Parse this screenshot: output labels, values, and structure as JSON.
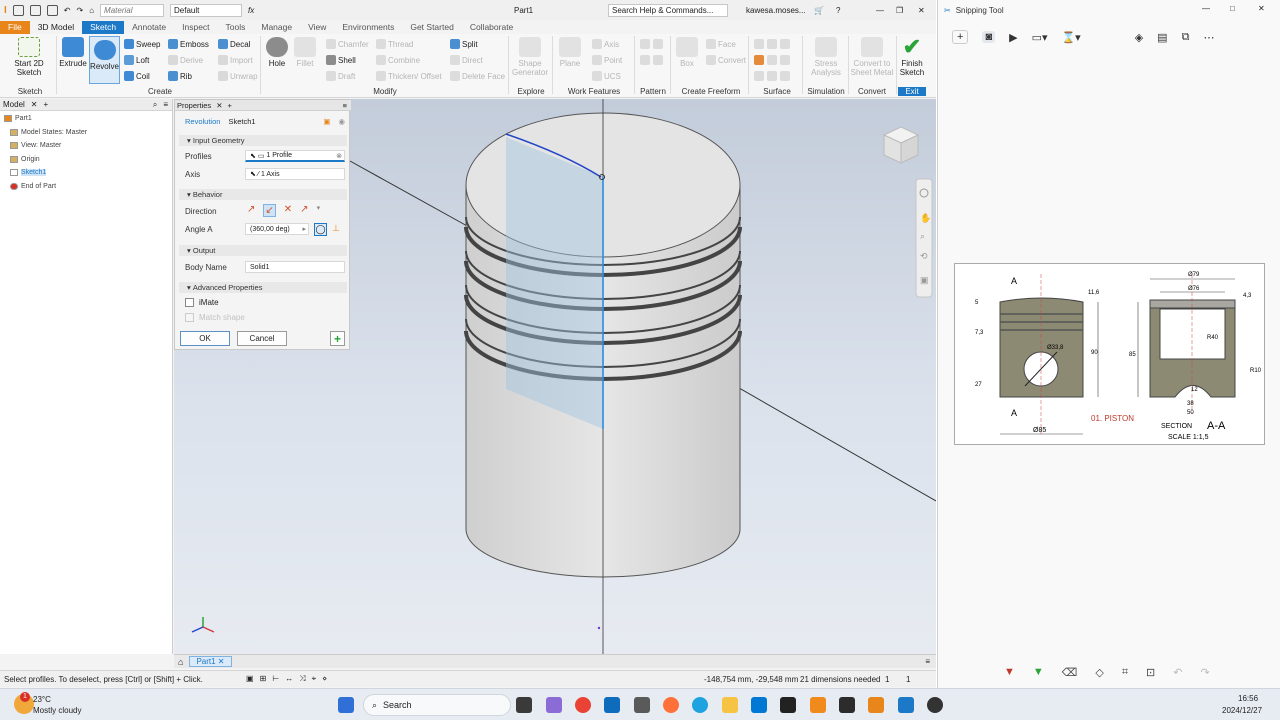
{
  "qat": {
    "material": "Material",
    "appearance": "Default",
    "title": "Part1",
    "search_placeholder": "Search Help & Commands...",
    "user": "kawesa.moses..."
  },
  "tabs": [
    "File",
    "3D Model",
    "Sketch",
    "Annotate",
    "Inspect",
    "Tools",
    "Manage",
    "View",
    "Environments",
    "Get Started",
    "Collaborate"
  ],
  "ribbon": {
    "start_sketch": "Start 2D Sketch",
    "extrude": "Extrude",
    "revolve": "Revolve",
    "sweep": "Sweep",
    "emboss": "Emboss",
    "decal": "Decal",
    "loft": "Loft",
    "derive": "Derive",
    "coil": "Coil",
    "import": "Import",
    "rib": "Rib",
    "unwrap": "Unwrap",
    "hole": "Hole",
    "fillet": "Fillet",
    "chamfer": "Chamfer",
    "thread": "Thread",
    "split": "Split",
    "shell": "Shell",
    "combine": "Combine",
    "direct": "Direct",
    "draft": "Draft",
    "thicken": "Thicken/ Offset",
    "delete_face": "Delete Face",
    "shape_generator": "Shape Generator",
    "plane": "Plane",
    "axis": "Axis",
    "point": "Point",
    "ucs": "UCS",
    "box": "Box",
    "face": "Face",
    "convert": "Convert",
    "stress": "Stress Analysis",
    "convert_sm": "Convert to Sheet Metal",
    "finish_sketch": "Finish Sketch",
    "groups": {
      "sketch": "Sketch",
      "create": "Create",
      "modify": "Modify",
      "explore": "Explore",
      "work": "Work Features",
      "pattern": "Pattern",
      "freeform": "Create Freeform",
      "surface": "Surface",
      "simulation": "Simulation",
      "convert": "Convert",
      "exit": "Exit"
    }
  },
  "browser": {
    "tab": "Model",
    "items": [
      "Part1",
      "Model States: Master",
      "View: Master",
      "Origin",
      "Sketch1",
      "End of Part"
    ]
  },
  "props": {
    "tab": "Properties",
    "feature": "Revolution",
    "sketch": "Sketch1",
    "input_geometry": "Input Geometry",
    "profiles_label": "Profiles",
    "profiles_value": "1 Profile",
    "axis_label": "Axis",
    "axis_value": "1 Axis",
    "behavior": "Behavior",
    "direction_label": "Direction",
    "angle_label": "Angle A",
    "angle_value": "(360,00 deg)",
    "output": "Output",
    "body_label": "Body Name",
    "body_value": "Solid1",
    "advanced": "Advanced Properties",
    "imate": "iMate",
    "match_shape": "Match shape",
    "ok": "OK",
    "cancel": "Cancel"
  },
  "doc_tab": "Part1",
  "status": {
    "hint": "Select profiles. To deselect, press [Ctrl] or [Shift] + Click.",
    "coords": "-148,754 mm, -29,548 mm",
    "dims": "21 dimensions needed",
    "a": "1",
    "b": "1"
  },
  "snip": {
    "title": "Snipping Tool",
    "drawing": {
      "a1": "A",
      "a2": "A",
      "d79": "Ø79",
      "d76": "Ø76",
      "d338": "Ø33,8",
      "d85": "Ø85",
      "v116": "11,6",
      "v5": "5",
      "v73": "7,3",
      "v27": "27",
      "v90": "90",
      "v85": "85",
      "v43": "4,3",
      "r40": "R40",
      "r10": "R10",
      "v12": "12",
      "v38": "38",
      "v50": "50",
      "piston": "01. PISTON",
      "section": "SECTION",
      "section_aa": "A-A",
      "scale": "SCALE 1:1,5"
    }
  },
  "taskbar": {
    "temp": "23°C",
    "weather": "Mostly cloudy",
    "search": "Search",
    "time": "16:56",
    "date": "2024/12/27",
    "badge": "1"
  }
}
